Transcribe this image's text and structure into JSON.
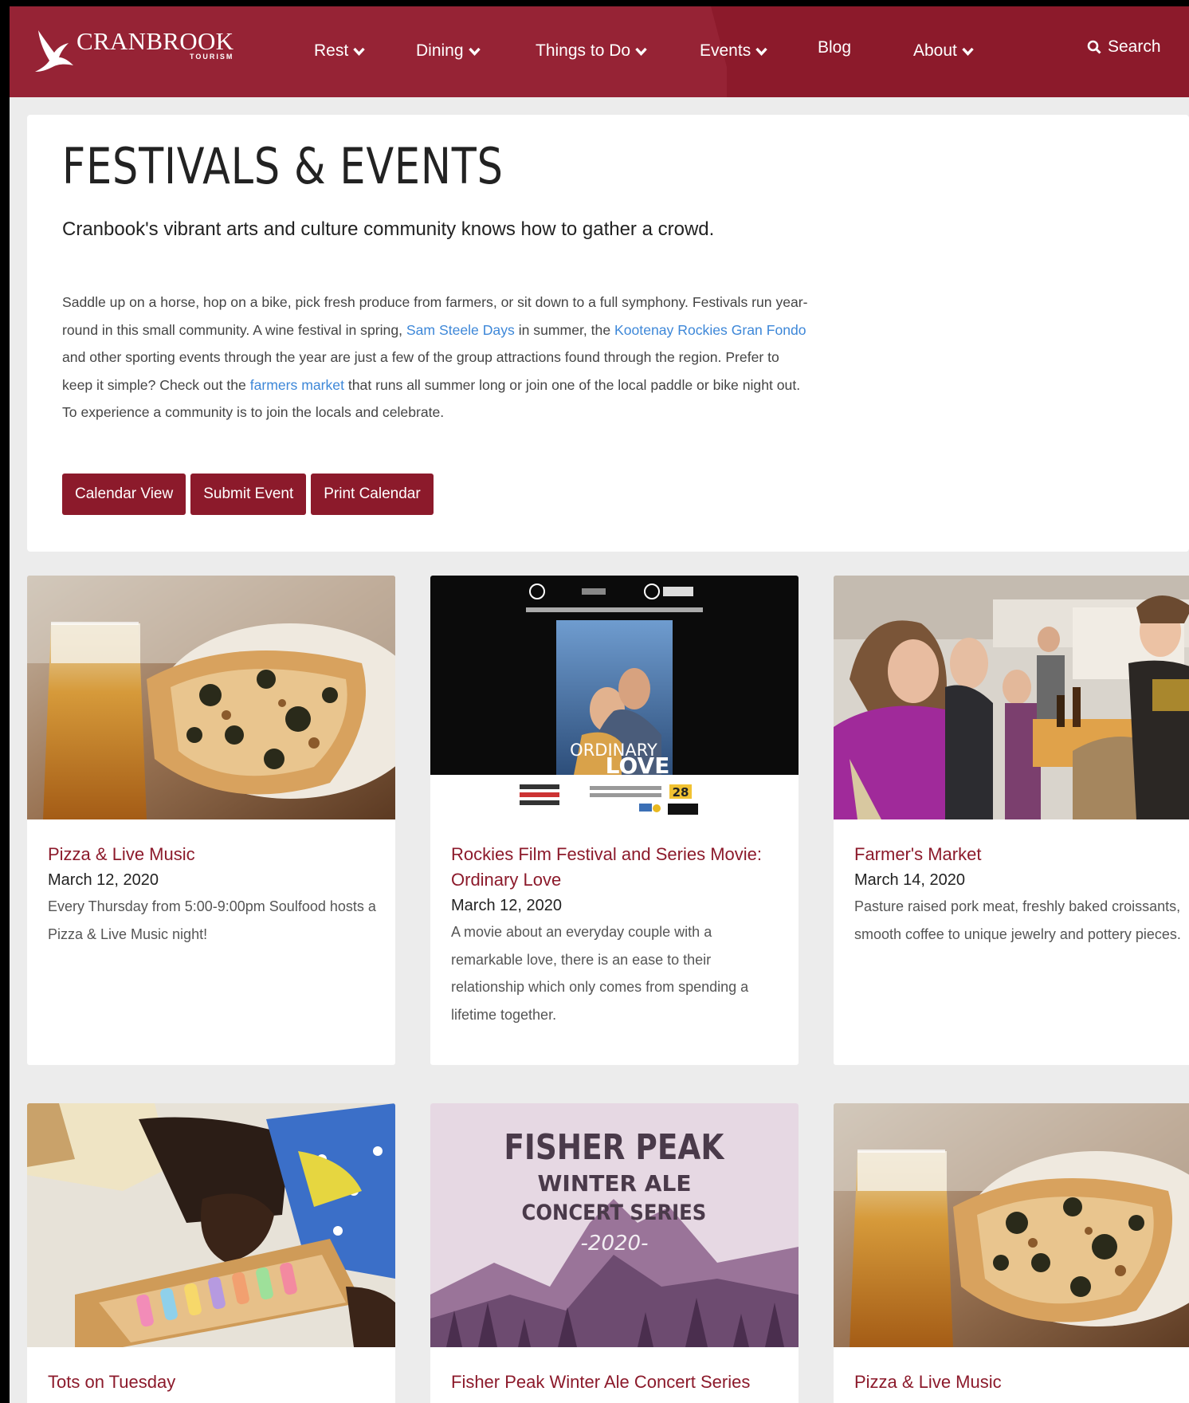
{
  "header": {
    "logo": {
      "brand": "CRANBROOK",
      "sub": "TOURISM"
    },
    "nav": [
      {
        "label": "Rest",
        "dropdown": true
      },
      {
        "label": "Dining",
        "dropdown": true
      },
      {
        "label": "Things to Do",
        "dropdown": true
      },
      {
        "label": "Events",
        "dropdown": true
      },
      {
        "label": "Blog",
        "dropdown": false
      },
      {
        "label": "About",
        "dropdown": true
      }
    ],
    "search_label": "Search"
  },
  "intro": {
    "title": "FESTIVALS & EVENTS",
    "lead": "Cranbook's vibrant arts and culture community knows how to gather a crowd.",
    "body": {
      "p1": "Saddle up on a horse, hop on a bike, pick fresh produce from farmers, or sit down to a full symphony. Festivals run year-round in this small community. A wine festival in spring, ",
      "link1": "Sam Steele Days",
      "p2": " in summer, the ",
      "link2": "Kootenay Rockies Gran Fondo",
      "p3": " and other sporting events through the year are just a few of the group attractions found through the region. Prefer to keep it simple? Check out the ",
      "link3": "farmers market",
      "p4": " that runs all summer long or join one of the local paddle or bike night out. To experience a community is to join the locals and celebrate."
    },
    "buttons": [
      "Calendar View",
      "Submit Event",
      "Print Calendar"
    ]
  },
  "cards": [
    {
      "title": "Pizza & Live Music",
      "date": "March 12, 2020",
      "desc": "Every Thursday from 5:00-9:00pm Soulfood hosts a Pizza & Live Music night!"
    },
    {
      "title": "Rockies Film Festival and Series Movie: Ordinary Love",
      "date": "March 12, 2020",
      "desc": "A movie about an everyday couple with a remarkable love, there is an ease to their relationship which only comes from spending a lifetime together.",
      "poster": {
        "line1": "ORDINARY",
        "line2": "LOVE",
        "badge": "28"
      }
    },
    {
      "title": "Farmer's Market",
      "date": "March 14, 2020",
      "desc": "Pasture raised pork meat, freshly baked croissants, smooth coffee to unique jewelry and pottery pieces."
    },
    {
      "title": "Tots on Tuesday",
      "date": "",
      "desc": ""
    },
    {
      "title": "Fisher Peak Winter Ale Concert Series",
      "date": "",
      "desc": "",
      "poster": {
        "line1": "FISHER PEAK",
        "line2": "WINTER ALE",
        "line3": "CONCERT SERIES",
        "line4": "-2020-"
      }
    },
    {
      "title": "Pizza & Live Music",
      "date": "",
      "desc": ""
    }
  ],
  "colors": {
    "brand": "#8c1a2b",
    "link": "#3d87d8",
    "background": "#ececec"
  }
}
